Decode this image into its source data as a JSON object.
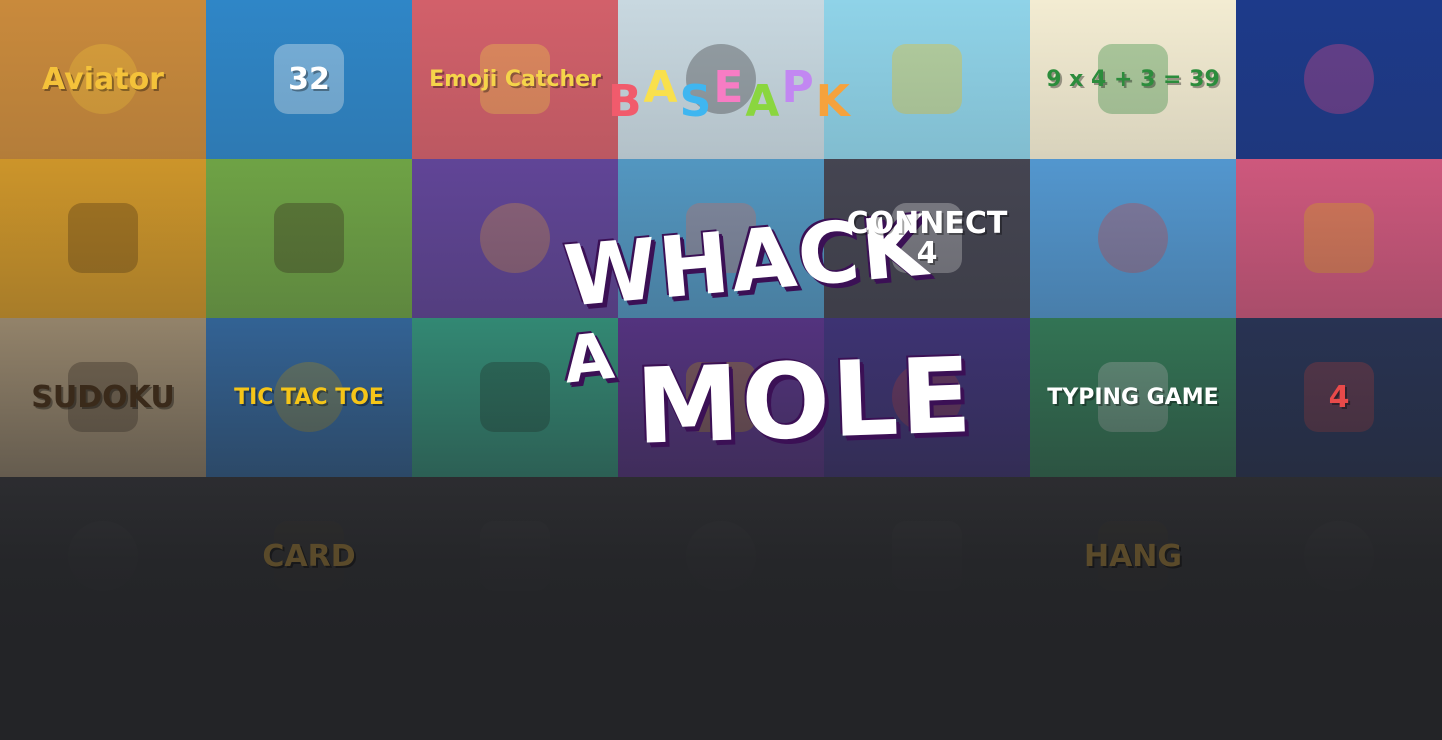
{
  "game": {
    "brand_letters": [
      "B",
      "A",
      "S",
      "E",
      "A",
      "P",
      "K"
    ],
    "brand_colors": [
      "#f15b6c",
      "#f9e04c",
      "#3fb6f0",
      "#f77cc4",
      "#8ad63f",
      "#c287f2",
      "#f6a23c"
    ],
    "title_line1": "WHACK",
    "title_line2": "A",
    "title_line3": "MOLE",
    "title_color": "#ffffff",
    "title_shadow_color": "#3b1055",
    "background_color": "#232427"
  },
  "tiles": [
    {
      "name": "tile-aviator",
      "label": "Aviator",
      "bg": "#c98a3c",
      "fg": "#f4c23a",
      "icon": "biplane-icon"
    },
    {
      "name": "tile-2048-balls",
      "label": "32",
      "bg": "#2f86c7",
      "fg": "#ffffff",
      "icon": "ball-chain-icon"
    },
    {
      "name": "tile-emoji-catcher",
      "label": "Emoji Catcher",
      "bg": "#d2606a",
      "fg": "#f5d44a",
      "icon": "emoji-icon"
    },
    {
      "name": "tile-ping-pong",
      "label": "",
      "bg": "#c8d8e0",
      "fg": "#333333",
      "icon": "ping-pong-icon"
    },
    {
      "name": "tile-flappy",
      "label": "",
      "bg": "#8fd3e8",
      "fg": "#f5c518",
      "icon": "bird-icon"
    },
    {
      "name": "tile-math-game",
      "label": "9 x 4 + 3 = 39",
      "bg": "#f3ecd2",
      "fg": "#2c8c3c",
      "icon": "equation-icon"
    },
    {
      "name": "tile-shapes",
      "label": "",
      "bg": "#1d3a8a",
      "fg": "#e84a8a",
      "icon": "shapes-icon"
    },
    {
      "name": "tile-hangman",
      "label": "",
      "bg": "#e6a62a",
      "fg": "#5a3a12",
      "icon": "hangman-icon"
    },
    {
      "name": "tile-whack-a-mole",
      "label": "",
      "bg": "#7ab64a",
      "fg": "#3a2a1a",
      "icon": "mole-icon"
    },
    {
      "name": "tile-bubble-sort",
      "label": "",
      "bg": "#6a4aa8",
      "fg": "#f4a84a",
      "icon": "bubbles-icon"
    },
    {
      "name": "tile-memory",
      "label": "",
      "bg": "#5aa8d8",
      "fg": "#f27a6a",
      "icon": "cards-icon"
    },
    {
      "name": "tile-connect-4",
      "label": "CONNECT 4",
      "bg": "#4a4a58",
      "fg": "#ffffff",
      "icon": "connect-four-icon"
    },
    {
      "name": "tile-stack-blocks",
      "label": "",
      "bg": "#5aa8e8",
      "fg": "#e84a4a",
      "icon": "blocks-icon"
    },
    {
      "name": "tile-zigzag",
      "label": "",
      "bg": "#e8608a",
      "fg": "#f5c518",
      "icon": "cube-icon"
    },
    {
      "name": "tile-sudoku",
      "label": "SUDOKU",
      "bg": "#c8b08a",
      "fg": "#3a2a1a",
      "icon": "grid-icon"
    },
    {
      "name": "tile-tic-tac-toe",
      "label": "TIC TAC TOE",
      "bg": "#3a80c8",
      "fg": "#f5c518",
      "icon": "xo-icon"
    },
    {
      "name": "tile-maze",
      "label": "",
      "bg": "#3ab898",
      "fg": "#1a3a2a",
      "icon": "maze-icon"
    },
    {
      "name": "tile-pac",
      "label": "",
      "bg": "#6a3aa8",
      "fg": "#f5c518",
      "icon": "pac-icon"
    },
    {
      "name": "tile-tetris",
      "label": "",
      "bg": "#4a3a98",
      "fg": "#e84a4a",
      "icon": "tetris-icon"
    },
    {
      "name": "tile-typing-game",
      "label": "TYPING GAME",
      "bg": "#3a9a6a",
      "fg": "#ffffff",
      "icon": "keyboard-icon"
    },
    {
      "name": "tile-four-in-row",
      "label": "4",
      "bg": "#2a3a68",
      "fg": "#e84a4a",
      "icon": "dots-icon"
    },
    {
      "name": "tile-row4-1",
      "label": "",
      "bg": "#3a3a3e",
      "fg": "#555555",
      "icon": "game-icon"
    },
    {
      "name": "tile-row4-2",
      "label": "CARD",
      "bg": "#3a3a3e",
      "fg": "#5a4a2a",
      "icon": "card-icon"
    },
    {
      "name": "tile-row4-3",
      "label": "",
      "bg": "#3a3a3e",
      "fg": "#555555",
      "icon": "game-icon"
    },
    {
      "name": "tile-row4-4",
      "label": "",
      "bg": "#3a3a3e",
      "fg": "#555555",
      "icon": "game-icon"
    },
    {
      "name": "tile-row4-5",
      "label": "",
      "bg": "#3a3a3e",
      "fg": "#555555",
      "icon": "game-icon"
    },
    {
      "name": "tile-row4-6",
      "label": "HANG",
      "bg": "#3a3a3e",
      "fg": "#5a4a2a",
      "icon": "hangman-icon"
    },
    {
      "name": "tile-row4-7",
      "label": "",
      "bg": "#3a3a3e",
      "fg": "#555555",
      "icon": "game-icon"
    }
  ]
}
